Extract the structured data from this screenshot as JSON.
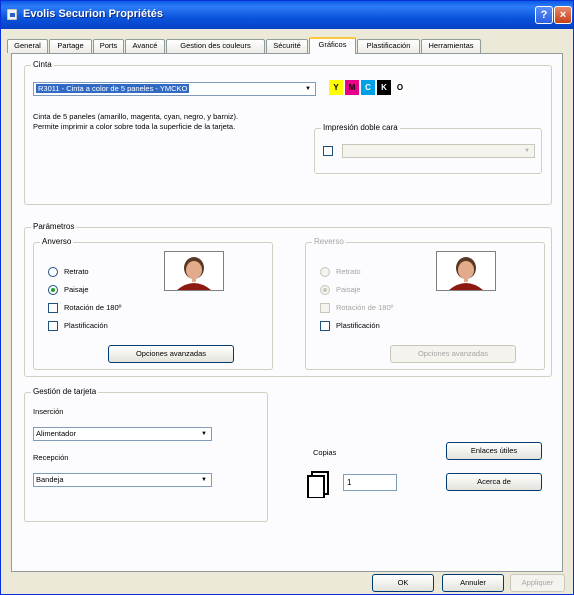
{
  "window": {
    "title": "Evolis Securion Propriétés",
    "help_label": "?",
    "close_label": "×"
  },
  "tabs": [
    "General",
    "Partage",
    "Ports",
    "Avancé",
    "Gestion des couleurs",
    "Sécurité",
    "Gráficos",
    "Plastificación",
    "Herramientas"
  ],
  "active_tab": "Gráficos",
  "cinta": {
    "legend": "Cinta",
    "ribbon_selected": "R3011 - Cinta a color de 5 paneles - YMCKO",
    "panels": [
      {
        "letter": "Y",
        "bg": "#ffff00",
        "fg": "#000000"
      },
      {
        "letter": "M",
        "bg": "#e8008a",
        "fg": "#000000"
      },
      {
        "letter": "C",
        "bg": "#00a0e6",
        "fg": "#ffffff"
      },
      {
        "letter": "K",
        "bg": "#000000",
        "fg": "#ffffff"
      },
      {
        "letter": "O",
        "bg": "#ffffff",
        "fg": "#000000"
      }
    ],
    "description_line1": "Cinta de 5 paneles (amarillo, magenta, cyan, negro, y barniz).",
    "description_line2": "Permite imprimir a color sobre toda la superficie de la tarjeta.",
    "duplex_legend": "Impresión doble cara",
    "duplex_value": ""
  },
  "parametros": {
    "legend": "Parámetros",
    "front": {
      "legend": "Anverso",
      "retrato": "Retrato",
      "paisaje": "Paisaje",
      "rotacion": "Rotación de 180º",
      "plastificacion": "Plastificación",
      "options_button": "Opciones avanzadas"
    },
    "back": {
      "legend": "Reverso",
      "retrato": "Retrato",
      "paisaje": "Paisaje",
      "rotacion": "Rotación de 180º",
      "plastificacion": "Plastificación",
      "options_button": "Opciones avanzadas"
    }
  },
  "gestion": {
    "legend": "Gestión de tarjeta",
    "insercion_label": "Inserción",
    "insercion_value": "Alimentador",
    "recepcion_label": "Recepción",
    "recepcion_value": "Bandeja"
  },
  "copias": {
    "label": "Copias",
    "value": "1"
  },
  "buttons": {
    "enlaces": "Enlaces útiles",
    "acerca": "Acerca de",
    "ok": "OK",
    "cancel": "Annuler",
    "apply": "Appliquer"
  }
}
